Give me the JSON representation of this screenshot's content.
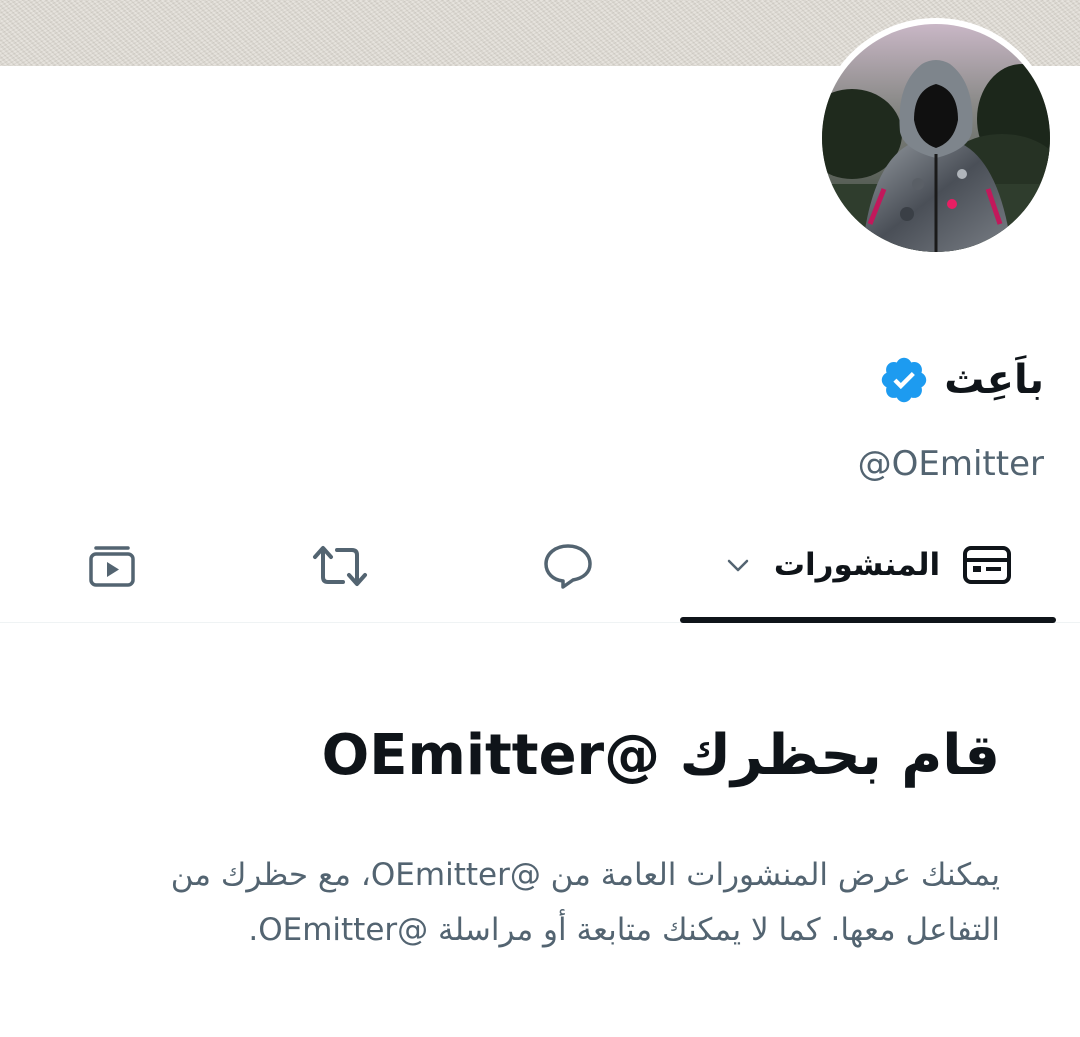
{
  "profile": {
    "display_name": "باَعِث",
    "handle": "@OEmitter",
    "verified": true
  },
  "tabs": {
    "posts_label": "المنشورات",
    "active": "posts"
  },
  "blocked_notice": {
    "title": "قام بحظرك @OEmitter",
    "description": "يمكنك عرض المنشورات العامة من @OEmitter، مع حظرك من التفاعل معها. كما لا يمكنك متابعة أو مراسلة @OEmitter."
  },
  "colors": {
    "text_primary": "#0f1419",
    "text_secondary": "#536471",
    "verified_blue": "#1d9bf0",
    "icon_gray": "#536471"
  }
}
